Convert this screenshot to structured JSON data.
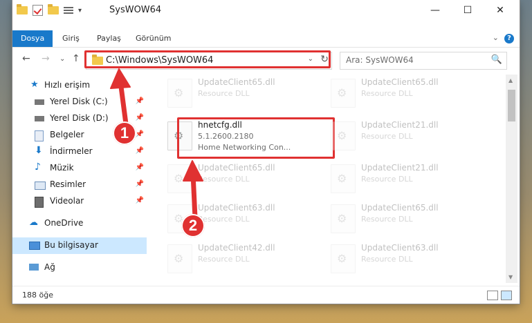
{
  "window": {
    "title": "SysWOW64",
    "controls": [
      "—",
      "☐",
      "✕"
    ]
  },
  "ribbon": {
    "tabs": [
      "Dosya",
      "Giriş",
      "Paylaş",
      "Görünüm"
    ],
    "active_index": 0,
    "expand_glyph": "⌄",
    "help_glyph": "?"
  },
  "nav": {
    "back": "←",
    "forward": "→",
    "recent": "⌄",
    "up": "↑",
    "address": "C:\\Windows\\SysWOW64",
    "dropdown_glyph": "⌄",
    "refresh_glyph": "↻"
  },
  "search": {
    "placeholder": "Ara: SysWOW64",
    "icon": "🔍"
  },
  "sidebar": {
    "items": [
      {
        "label": "Hızlı erişim",
        "icon": "star-icon",
        "pinned": false
      },
      {
        "label": "Yerel Disk (C:)",
        "icon": "drive-icon",
        "pinned": true
      },
      {
        "label": "Yerel Disk (D:)",
        "icon": "drive-icon",
        "pinned": true
      },
      {
        "label": "Belgeler",
        "icon": "documents-icon",
        "pinned": true
      },
      {
        "label": "İndirmeler",
        "icon": "downloads-icon",
        "pinned": true
      },
      {
        "label": "Müzik",
        "icon": "music-icon",
        "pinned": true
      },
      {
        "label": "Resimler",
        "icon": "pictures-icon",
        "pinned": true
      },
      {
        "label": "Videolar",
        "icon": "videos-icon",
        "pinned": true
      },
      {
        "label": "OneDrive",
        "icon": "cloud-icon",
        "pinned": false
      },
      {
        "label": "Bu bilgisayar",
        "icon": "computer-icon",
        "pinned": false,
        "selected": true
      },
      {
        "label": "Ağ",
        "icon": "network-icon",
        "pinned": false
      }
    ],
    "pin_glyph": "📌"
  },
  "files": [
    {
      "name": "UpdateClient65.dll",
      "type": "Resource DLL",
      "faded": true
    },
    {
      "name": "UpdateClient65.dll",
      "type": "Resource DLL",
      "faded": true
    },
    {
      "name": "hnetcfg.dll",
      "version": "5.1.2600.2180",
      "description": "Home Networking Con...",
      "faded": false
    },
    {
      "name": "UpdateClient21.dll",
      "type": "Resource DLL",
      "faded": true
    },
    {
      "name": "UpdateClient65.dll",
      "type": "Resource DLL",
      "faded": true
    },
    {
      "name": "UpdateClient21.dll",
      "type": "Resource DLL",
      "faded": true
    },
    {
      "name": "UpdateClient63.dll",
      "type": "Resource DLL",
      "faded": true
    },
    {
      "name": "UpdateClient65.dll",
      "type": "Resource DLL",
      "faded": true
    },
    {
      "name": "UpdateClient42.dll",
      "type": "Resource DLL",
      "faded": true
    },
    {
      "name": "UpdateClient63.dll",
      "type": "Resource DLL",
      "faded": true
    }
  ],
  "status": {
    "item_count": "188 öğe"
  },
  "callouts": [
    "1",
    "2"
  ],
  "colors": {
    "accent": "#1979ca",
    "highlight": "#e03131",
    "selection": "#cce8ff",
    "folder": "#f2c94c"
  }
}
